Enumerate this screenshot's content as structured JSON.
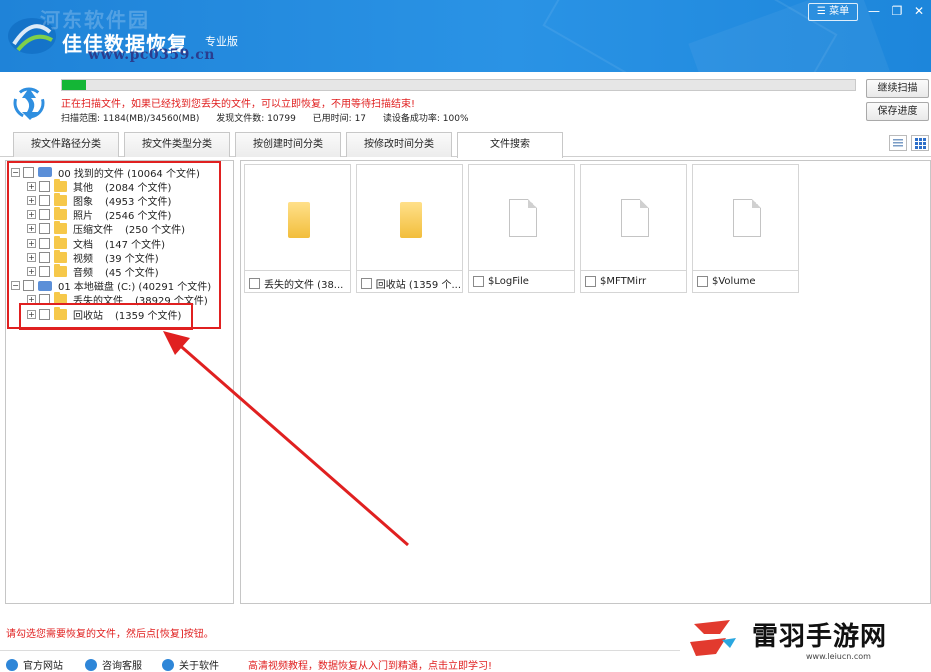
{
  "header": {
    "watermark": "河东软件园",
    "title": "佳佳数据恢复",
    "edition": "专业版",
    "site": "www.pc0359.cn",
    "menu_label": "菜单",
    "colors": {
      "bar": "#2a93e5",
      "accent_red": "#e02020",
      "progress_green": "#14b636"
    }
  },
  "scan": {
    "progress_fraction": 0.03,
    "status": "正在扫描文件，如果已经找到您丢失的文件，可以立即恢复，不用等待扫描结束!",
    "range": "扫描范围: 1184(MB)/34560(MB)",
    "found": "发现文件数: 10799",
    "elapsed": "已用时间: 17",
    "read_rate": "读设备成功率: 100%",
    "continue_button": "继续扫描",
    "save_button": "保存进度"
  },
  "tabs": [
    "按文件路径分类",
    "按文件类型分类",
    "按创建时间分类",
    "按修改时间分类",
    "文件搜索"
  ],
  "tree": [
    {
      "label": "00 找到的文件 (10064 个文件)",
      "count": "",
      "level": 0,
      "icon": "disk"
    },
    {
      "label": "其他",
      "count": "(2084 个文件)",
      "level": 1,
      "icon": "folder"
    },
    {
      "label": "图象",
      "count": "(4953 个文件)",
      "level": 1,
      "icon": "folder"
    },
    {
      "label": "照片",
      "count": "(2546 个文件)",
      "level": 1,
      "icon": "folder"
    },
    {
      "label": "压缩文件",
      "count": "(250 个文件)",
      "level": 1,
      "icon": "folder"
    },
    {
      "label": "文档",
      "count": "(147 个文件)",
      "level": 1,
      "icon": "folder"
    },
    {
      "label": "视频",
      "count": "(39 个文件)",
      "level": 1,
      "icon": "folder"
    },
    {
      "label": "音频",
      "count": "(45 个文件)",
      "level": 1,
      "icon": "folder"
    },
    {
      "label": "01 本地磁盘 (C:) (40291 个文件)",
      "count": "",
      "level": 0,
      "icon": "disk"
    },
    {
      "label": "丢失的文件",
      "count": "(38929 个文件)",
      "level": 1,
      "icon": "folder"
    },
    {
      "label": "回收站",
      "count": "(1359 个文件)",
      "level": 1,
      "icon": "folder"
    }
  ],
  "files": [
    {
      "name": "丢失的文件 (38...",
      "icon": "folder-icon"
    },
    {
      "name": "回收站 (1359 个...",
      "icon": "folder-icon"
    },
    {
      "name": "$LogFile",
      "icon": "document-icon"
    },
    {
      "name": "$MFTMirr",
      "icon": "document-icon"
    },
    {
      "name": "$Volume",
      "icon": "document-icon"
    }
  ],
  "hint": "请勾选您需要恢复的文件，然后点[恢复]按钮。",
  "footer": {
    "links": [
      "官方网站",
      "咨询客服",
      "关于软件"
    ],
    "promo": "高清视频教程，数据恢复从入门到精通，点击立即学习!"
  },
  "badge": {
    "name": "雷羽手游网",
    "url": "www.leiucn.com"
  }
}
